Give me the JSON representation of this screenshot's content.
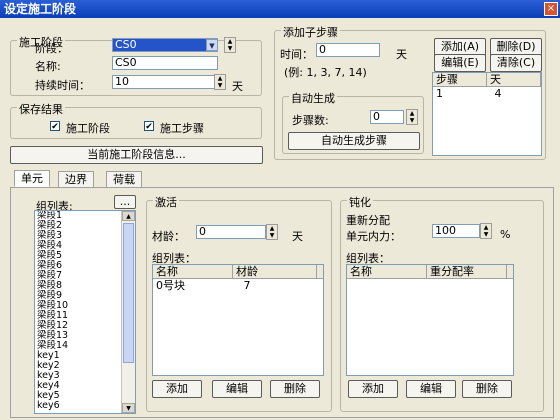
{
  "window": {
    "title": "设定施工阶段"
  },
  "stage": {
    "group_label": "施工阶段",
    "stage_label": "阶段：",
    "stage_value": "CS0",
    "name_label": "名称:",
    "name_value": "CS0",
    "duration_label": "持续时间：",
    "duration_value": "10",
    "duration_unit": "天"
  },
  "save": {
    "group_label": "保存结果",
    "cb1_label": "施工阶段",
    "cb2_label": "施工步骤",
    "check_mark": "✔"
  },
  "current_info_button": "当前施工阶段信息...",
  "substep": {
    "group_label": "添加子步骤",
    "time_label": "时间：",
    "time_value": "0",
    "time_unit": "天",
    "example": "(例: 1, 3, 7, 14)",
    "add": "添加(A)",
    "delete": "删除(D)",
    "edit": "编辑(E)",
    "clear": "清除(C)",
    "table_headers": [
      "步骤",
      "天"
    ],
    "table_rows": [
      [
        "1",
        "4"
      ]
    ],
    "auto_group_label": "自动生成",
    "step_count_label": "步骤数:",
    "step_count_value": "0",
    "auto_button": "自动生成步骤"
  },
  "tabs": [
    "单元",
    "边界",
    "荷载"
  ],
  "group_list": {
    "label": "组列表:",
    "browse": "...",
    "items": [
      "梁段1",
      "梁段2",
      "梁段3",
      "梁段4",
      "梁段5",
      "梁段6",
      "梁段7",
      "梁段8",
      "梁段9",
      "梁段10",
      "梁段11",
      "梁段12",
      "梁段13",
      "梁段14",
      "key1",
      "key2",
      "key3",
      "key4",
      "key5",
      "key6"
    ]
  },
  "activate": {
    "group_label": "激活",
    "age_label": "材龄：",
    "age_value": "0",
    "age_unit": "天",
    "list_label": "组列表：",
    "headers": [
      "名称",
      "材龄"
    ],
    "rows": [
      [
        "0号块",
        "7"
      ]
    ],
    "add": "添加",
    "edit": "编辑",
    "delete": "删除"
  },
  "passivate": {
    "group_label": "钝化",
    "redistribute_label": "重新分配",
    "force_label": "单元内力：",
    "force_value": "100",
    "force_unit": "%",
    "list_label": "组列表：",
    "headers": [
      "名称",
      "重分配率"
    ],
    "rows": [],
    "add": "添加",
    "edit": "编辑",
    "delete": "删除"
  },
  "icons": {
    "dropdown": "▼",
    "spin_up": "▲",
    "spin_down": "▼",
    "close": "×"
  }
}
